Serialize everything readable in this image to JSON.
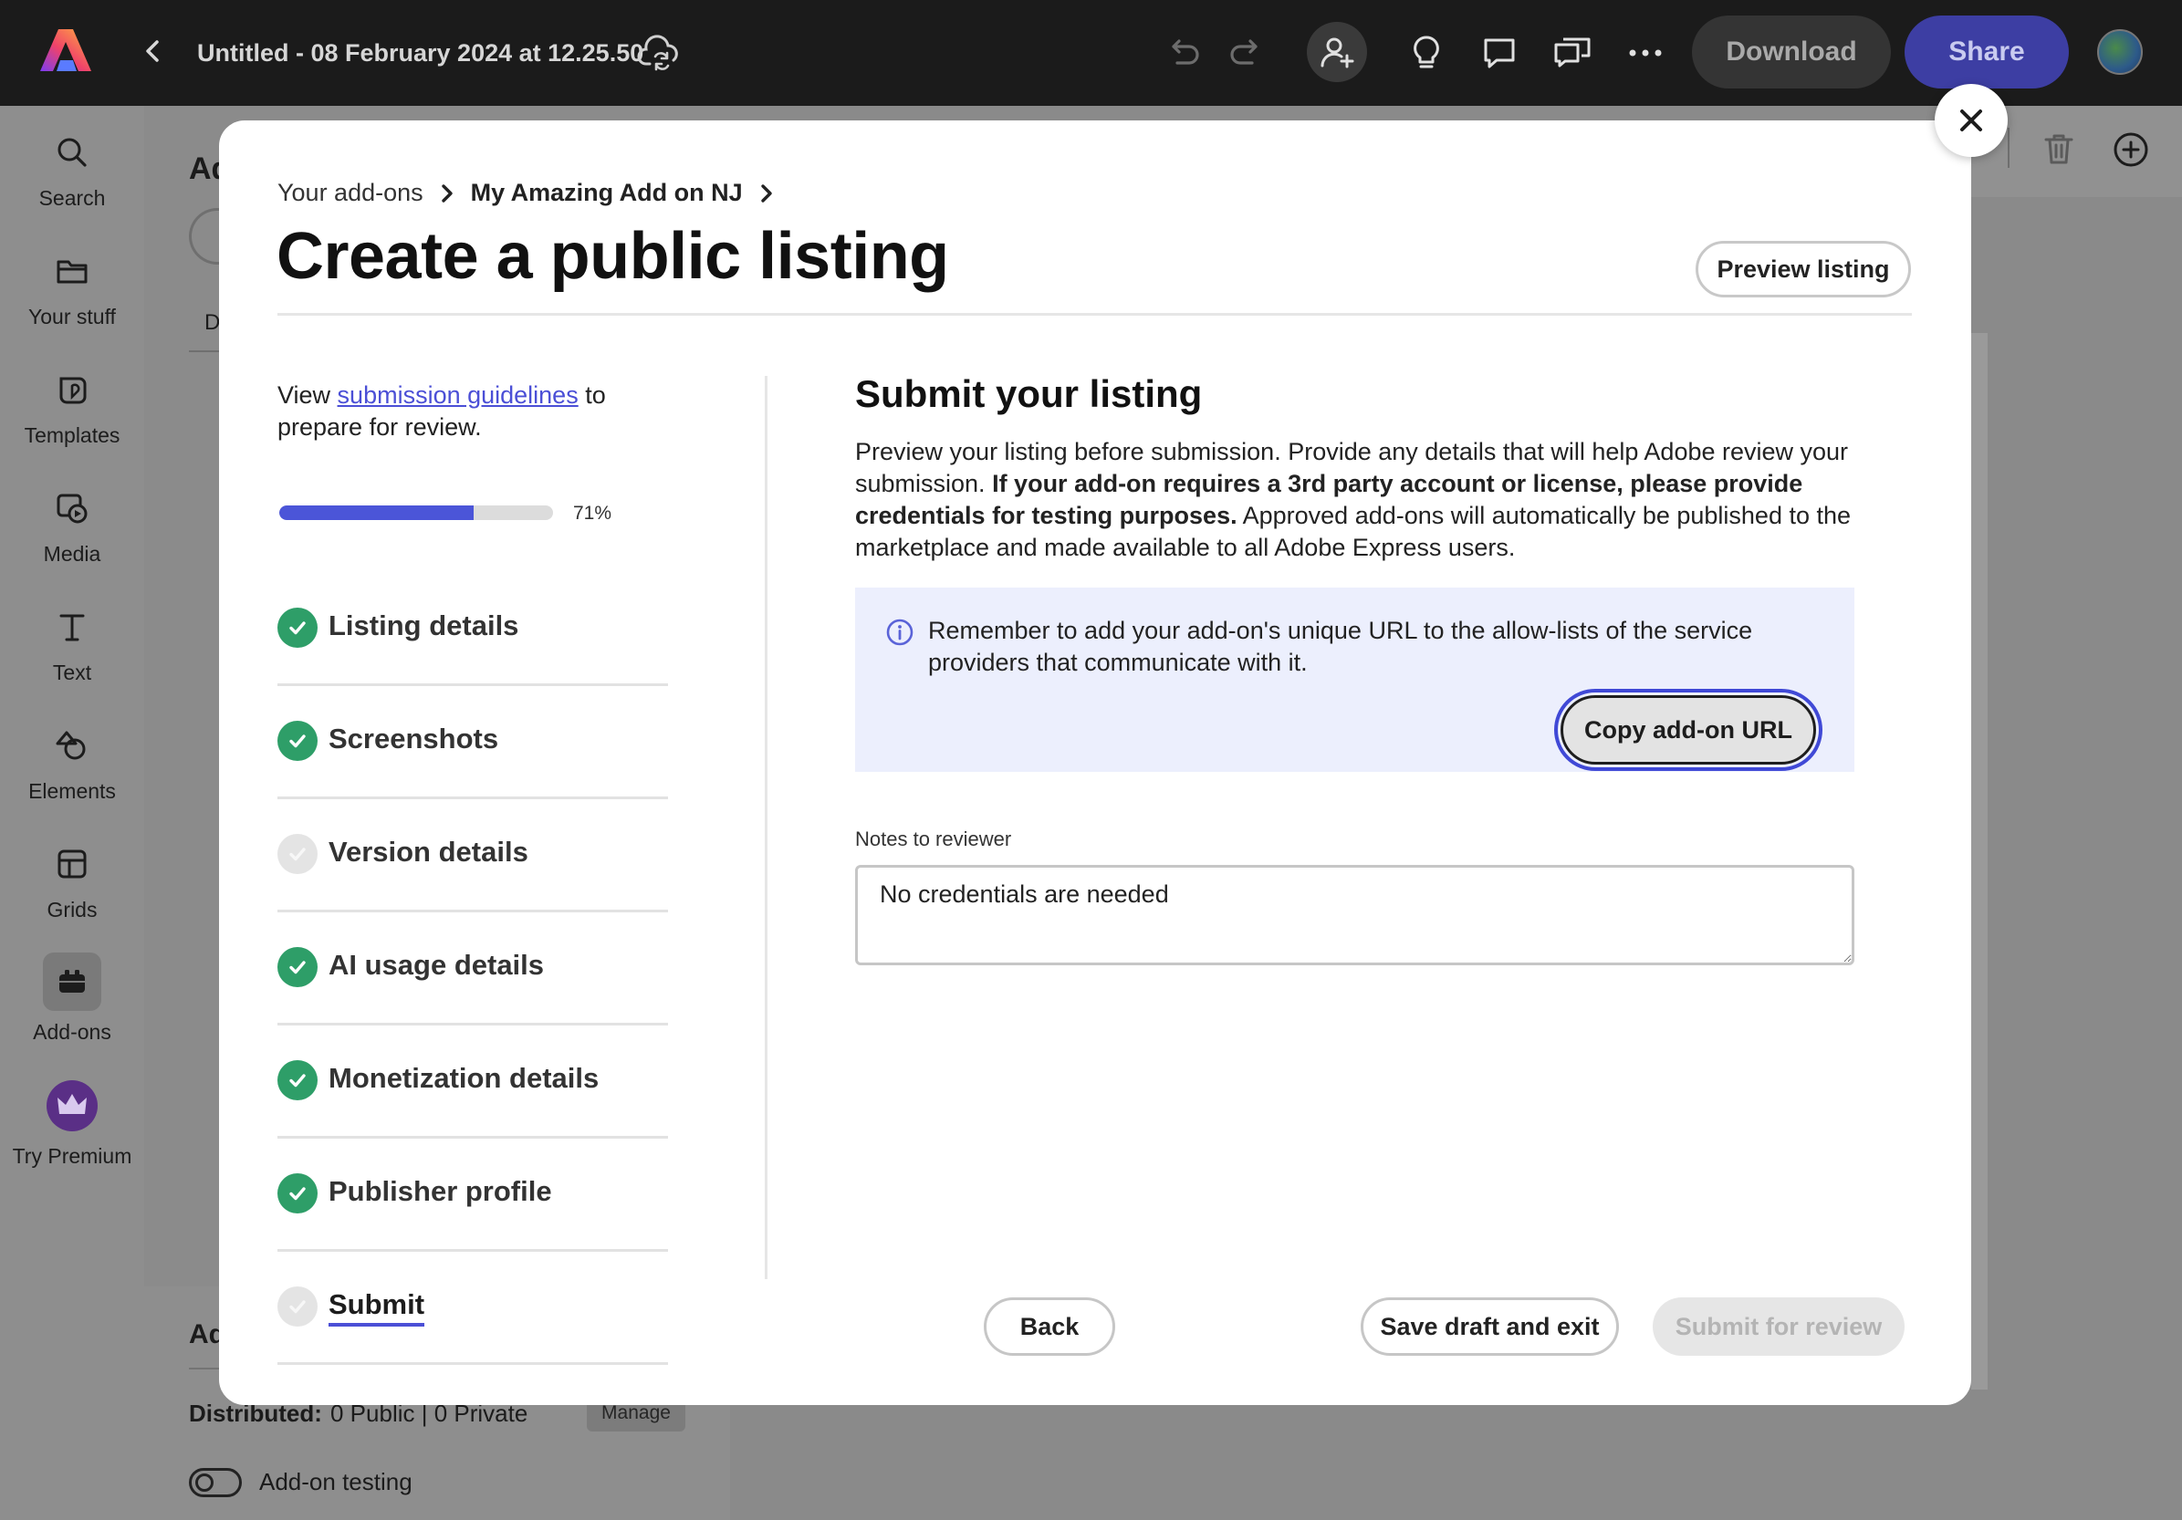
{
  "topbar": {
    "doc_title": "Untitled - 08 February 2024 at 12.25.50",
    "download_label": "Download",
    "share_label": "Share"
  },
  "rail": {
    "items": [
      {
        "label": "Search",
        "icon": "search-icon"
      },
      {
        "label": "Your stuff",
        "icon": "folder-icon"
      },
      {
        "label": "Templates",
        "icon": "templates-icon"
      },
      {
        "label": "Media",
        "icon": "media-icon"
      },
      {
        "label": "Text",
        "icon": "text-icon"
      },
      {
        "label": "Elements",
        "icon": "elements-icon"
      },
      {
        "label": "Grids",
        "icon": "grids-icon"
      },
      {
        "label": "Add-ons",
        "icon": "add-ons-icon"
      },
      {
        "label": "Try Premium",
        "icon": "crown-icon"
      }
    ]
  },
  "background_panel": {
    "heading_fragment": "Ad",
    "tab_fragment": "D",
    "lower_heading_fragment": "Ad",
    "distributed_label": "Distributed:",
    "distributed_value": "0 Public | 0 Private",
    "manage_label": "Manage",
    "testing_label": "Add-on testing"
  },
  "modal": {
    "breadcrumb": {
      "root": "Your add-ons",
      "current": "My Amazing Add on NJ"
    },
    "title": "Create a public listing",
    "preview_label": "Preview listing",
    "guide": {
      "before": "View ",
      "link": "submission guidelines",
      "after": " to prepare for review."
    },
    "progress": {
      "percent": 71,
      "label": "71%"
    },
    "steps": [
      {
        "label": "Listing details",
        "status": "complete"
      },
      {
        "label": "Screenshots",
        "status": "complete"
      },
      {
        "label": "Version details",
        "status": "incomplete"
      },
      {
        "label": "AI usage details",
        "status": "complete"
      },
      {
        "label": "Monetization details",
        "status": "complete"
      },
      {
        "label": "Publisher profile",
        "status": "complete"
      },
      {
        "label": "Submit",
        "status": "current"
      }
    ],
    "section": {
      "title": "Submit your listing",
      "desc_plain_1": "Preview your listing before submission. Provide any details that will help Adobe review your submission. ",
      "desc_bold": "If your add-on requires a 3rd party account or license, please provide credentials for testing purposes.",
      "desc_plain_2": " Approved add-ons will automatically be published to the marketplace and made available to all Adobe Express users."
    },
    "info": {
      "text": "Remember to add your add-on's unique URL to the allow-lists of the service providers that communicate with it.",
      "copy_label": "Copy add-on URL"
    },
    "notes": {
      "label": "Notes to reviewer",
      "value": "No credentials are needed"
    },
    "footer": {
      "back_label": "Back",
      "save_label": "Save draft and exit",
      "submit_label": "Submit for review"
    }
  },
  "colors": {
    "accent": "#4b4fd6",
    "success": "#2e9e68",
    "share_button": "#3d3ea3"
  }
}
